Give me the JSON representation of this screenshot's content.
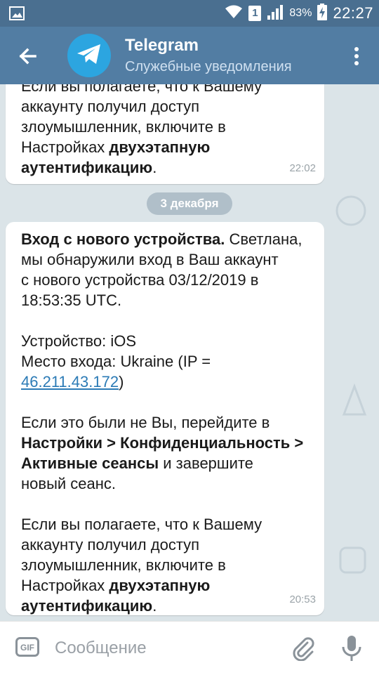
{
  "status_bar": {
    "battery_percent": "83%",
    "time": "22:27",
    "sim_label": "1",
    "icons": [
      "gallery-icon",
      "wifi-icon",
      "sim-icon",
      "signal-icon",
      "battery-charging-icon"
    ]
  },
  "app_bar": {
    "title": "Telegram",
    "subtitle": "Служебные уведомления",
    "back_icon": "back-arrow-icon",
    "menu_icon": "more-vert-icon",
    "avatar_icon": "telegram-logo-icon"
  },
  "messages": [
    {
      "lines": [
        {
          "parts": [
            {
              "t": "Если вы полагаете, что к Вашему",
              "b": false
            }
          ]
        },
        {
          "parts": [
            {
              "t": "аккаунту получил доступ",
              "b": false
            }
          ]
        },
        {
          "parts": [
            {
              "t": "злоумышленник, включите в",
              "b": false
            }
          ]
        },
        {
          "parts": [
            {
              "t": "Настройках ",
              "b": false
            },
            {
              "t": "двухэтапную",
              "b": true
            }
          ]
        },
        {
          "parts": [
            {
              "t": "аутентификацию",
              "b": true
            },
            {
              "t": ".",
              "b": false
            }
          ]
        }
      ],
      "time": "22:02"
    },
    {
      "date_separator": "3 декабря"
    },
    {
      "time": "20:53"
    }
  ],
  "msg2": {
    "p1_bold": "Вход с нового устройства.",
    "p1_rest1": " Светлана,",
    "p1_line2": "мы обнаружили вход в Ваш аккаунт",
    "p1_line3": "с нового устройства 03/12/2019 в",
    "p1_line4": "18:53:35 UTC.",
    "device_line": "Устройство: iOS",
    "location_line": "Место входа: Ukraine (IP =",
    "ip_link": "46.211.43.172",
    "ip_close": ")",
    "p3_line1": "Если это были не Вы, перейдите в",
    "p3_bold1": "Настройки > Конфиденциальность >",
    "p3_bold2": "Активные сеансы",
    "p3_rest2": " и завершите",
    "p3_line4": "новый сеанс.",
    "p4_line1": "Если вы полагаете, что к Вашему",
    "p4_line2": "аккаунту получил доступ",
    "p4_line3": "злоумышленник, включите в",
    "p4_line4_a": "Настройках ",
    "p4_line4_b": "двухэтапную",
    "p4_line5_b": "аутентификацию",
    "p4_line5_a": ".",
    "time": "20:53"
  },
  "msg1": {
    "line1": "Если вы полагаете, что к Вашему",
    "line2": "аккаунту получил доступ",
    "line3": "злоумышленник, включите в",
    "line4_a": "Настройках ",
    "line4_b": "двухэтапную",
    "line5_b": "аутентификацию",
    "line5_a": ".",
    "time": "22:02"
  },
  "date_separator": "3 декабря",
  "input_bar": {
    "gif_label": "GIF",
    "placeholder": "Сообщение",
    "attach_icon": "paperclip-icon",
    "mic_icon": "microphone-icon"
  },
  "colors": {
    "status_bar": "#4a6f90",
    "app_bar": "#527da3",
    "link": "#2c7bb6",
    "bubble": "#ffffff",
    "chat_bg": "#dbe4e8"
  }
}
